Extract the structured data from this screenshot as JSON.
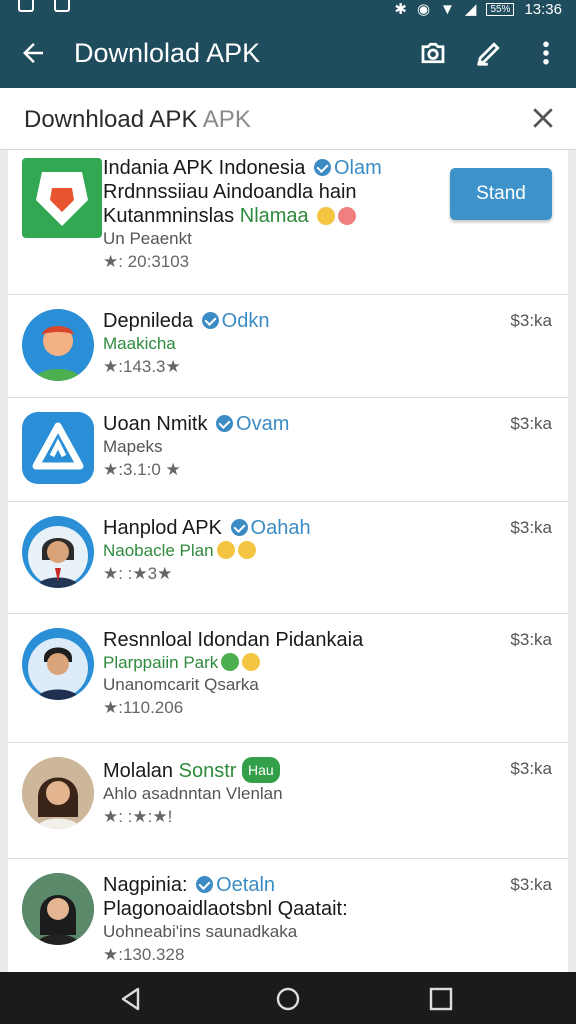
{
  "status_bar": {
    "battery": "55%",
    "time": "13:36"
  },
  "toolbar": {
    "title": "Downlolad APK"
  },
  "dialog": {
    "title_main": "Downhload APK",
    "title_sub": "APK"
  },
  "apps": [
    {
      "line1": "Indania APK Indonesia",
      "verified_label": "Olam",
      "line2": "Rrdnnssiiau Aindoandla hain",
      "line3_a": "Kutanmninslas",
      "line3_b": "Nlamaa",
      "line4": "Un Peaenkt",
      "rating": "★: 20:3103",
      "action": "Stand",
      "avatar_color": "#32a852"
    },
    {
      "line1": "Depnileda",
      "verified_label": "Odkn",
      "line2": "Maakicha",
      "rating": "★:143.3★",
      "price": "$3:ka",
      "avatar_color": "#2a8fd6"
    },
    {
      "line1": "Uoan Nmitk",
      "verified_label": "Ovam",
      "line2": "Mapeks",
      "rating": "★:3.1:0 ★",
      "price": "$3:ka",
      "avatar_color": "#2a8fd6"
    },
    {
      "line1": "Hanplod APK",
      "verified_label": "Oahah",
      "line2": "Naobacle Plan",
      "rating": "★: :★3★",
      "price": "$3:ka",
      "avatar_color": "#2a8fd6"
    },
    {
      "line1": "Resnnloal Idondan Pidankaia",
      "line2": "Plarppaiin Park",
      "line3": "Unanomcarit Qsarka",
      "rating": "★:110.206",
      "price": "$3:ka",
      "avatar_color": "#2a8fd6"
    },
    {
      "line1": "Molalan",
      "line1_green": "Sonstr",
      "tag": "Hau",
      "line2": "Ahlo asadnntan Vlenlan",
      "rating": "★: :★:★!",
      "price": "$3:ka",
      "avatar_color": "#c9a27a"
    },
    {
      "line1": "Nagpinia:",
      "verified_label": "Oetaln",
      "line2": "Plagonoaidlaotsbnl Qaatait:",
      "line3": "Uohneabi'ins saunadkaka",
      "rating": "★:130.328",
      "price": "$3:ka",
      "avatar_color": "#3f6e4d"
    }
  ],
  "nav": {
    "back": "back-triangle",
    "home": "home-circle",
    "recents": "recents-square"
  }
}
